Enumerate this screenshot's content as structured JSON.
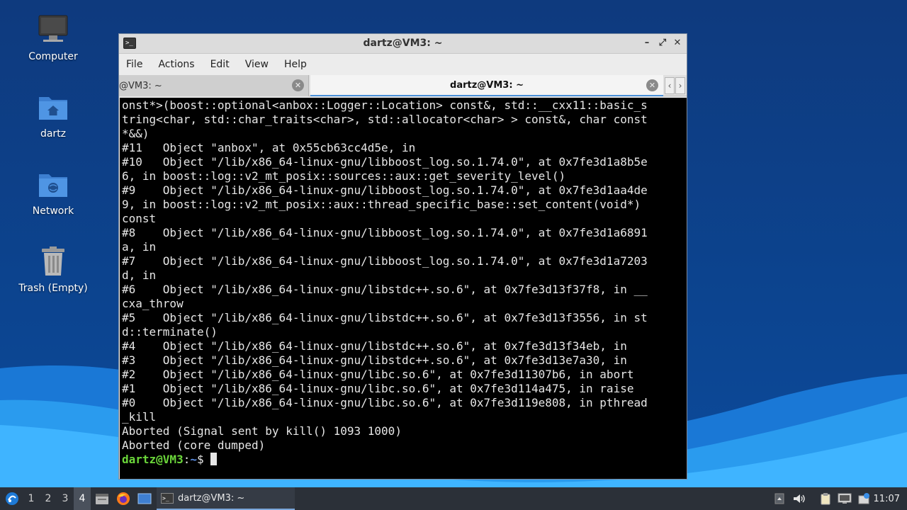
{
  "desktop": {
    "icons": [
      {
        "label": "Computer",
        "icon": "computer-icon"
      },
      {
        "label": "dartz",
        "icon": "home-folder-icon"
      },
      {
        "label": "Network",
        "icon": "network-folder-icon"
      },
      {
        "label": "Trash (Empty)",
        "icon": "trash-icon"
      }
    ]
  },
  "window": {
    "title": "dartz@VM3: ~",
    "buttons": {
      "minimize": "–",
      "maximize": "⤢",
      "close": "✕"
    },
    "menu": [
      "File",
      "Actions",
      "Edit",
      "View",
      "Help"
    ],
    "tabs": [
      {
        "label": "@VM3: ~",
        "active": false
      },
      {
        "label": "dartz@VM3: ~",
        "active": true
      }
    ],
    "tab_close": "✕",
    "tab_scroll_left": "‹",
    "tab_scroll_right": "›"
  },
  "terminal": {
    "lines": [
      "onst*>(boost::optional<anbox::Logger::Location> const&, std::__cxx11::basic_s",
      "tring<char, std::char_traits<char>, std::allocator<char> > const&, char const",
      "*&&)",
      "#11   Object \"anbox\", at 0x55cb63cc4d5e, in",
      "#10   Object \"/lib/x86_64-linux-gnu/libboost_log.so.1.74.0\", at 0x7fe3d1a8b5e",
      "6, in boost::log::v2_mt_posix::sources::aux::get_severity_level()",
      "#9    Object \"/lib/x86_64-linux-gnu/libboost_log.so.1.74.0\", at 0x7fe3d1aa4de",
      "9, in boost::log::v2_mt_posix::aux::thread_specific_base::set_content(void*)",
      "const",
      "#8    Object \"/lib/x86_64-linux-gnu/libboost_log.so.1.74.0\", at 0x7fe3d1a6891",
      "a, in",
      "#7    Object \"/lib/x86_64-linux-gnu/libboost_log.so.1.74.0\", at 0x7fe3d1a7203",
      "d, in",
      "#6    Object \"/lib/x86_64-linux-gnu/libstdc++.so.6\", at 0x7fe3d13f37f8, in __",
      "cxa_throw",
      "#5    Object \"/lib/x86_64-linux-gnu/libstdc++.so.6\", at 0x7fe3d13f3556, in st",
      "d::terminate()",
      "#4    Object \"/lib/x86_64-linux-gnu/libstdc++.so.6\", at 0x7fe3d13f34eb, in",
      "#3    Object \"/lib/x86_64-linux-gnu/libstdc++.so.6\", at 0x7fe3d13e7a30, in",
      "#2    Object \"/lib/x86_64-linux-gnu/libc.so.6\", at 0x7fe3d11307b6, in abort",
      "#1    Object \"/lib/x86_64-linux-gnu/libc.so.6\", at 0x7fe3d114a475, in raise",
      "#0    Object \"/lib/x86_64-linux-gnu/libc.so.6\", at 0x7fe3d119e808, in pthread",
      "_kill",
      "Aborted (Signal sent by kill() 1093 1000)",
      "Aborted (core dumped)"
    ],
    "prompt_user": "dartz@VM3",
    "prompt_colon": ":",
    "prompt_path": "~",
    "prompt_symbol": "$ "
  },
  "taskbar": {
    "workspaces": [
      "1",
      "2",
      "3",
      "4"
    ],
    "active_workspace": "4",
    "launchers": [
      "file-manager-icon",
      "firefox-icon",
      "show-desktop-icon"
    ],
    "task_label": "dartz@VM3: ~",
    "tray_icons": [
      "tray-up-arrow-icon",
      "volume-icon",
      "clipboard-icon",
      "network-display-icon",
      "update-notifier-icon"
    ],
    "clock": "11:07"
  }
}
